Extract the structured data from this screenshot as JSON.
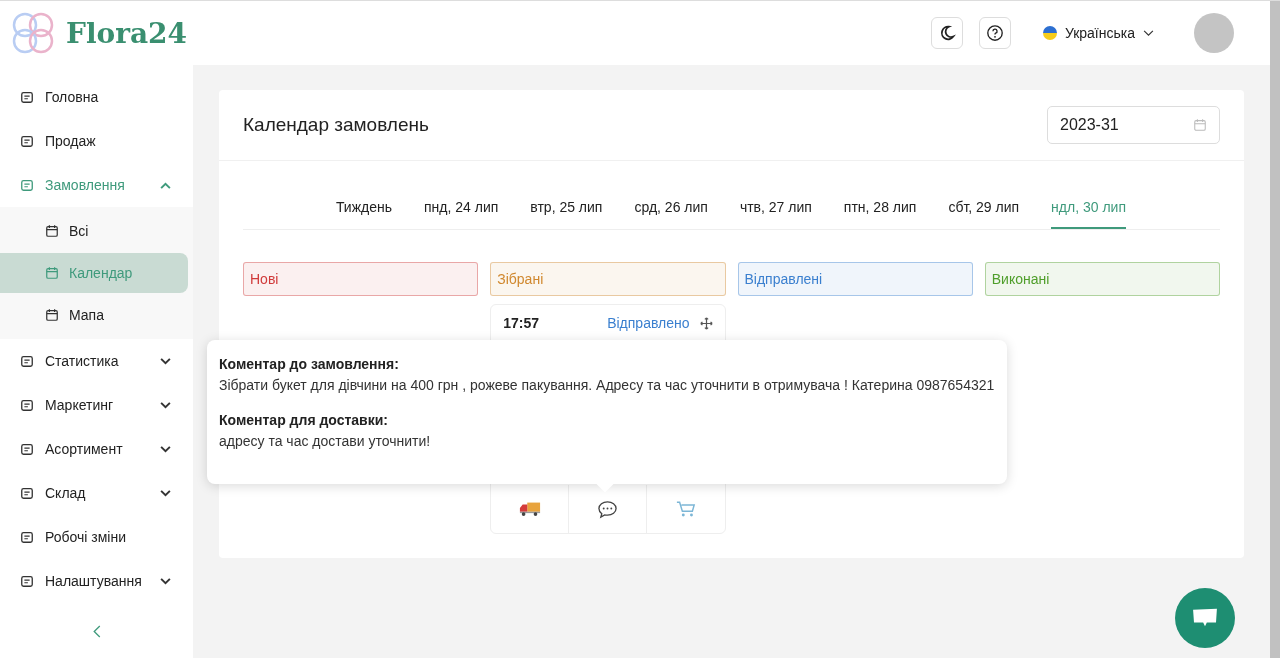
{
  "brand": {
    "name": "Flora24"
  },
  "header": {
    "language": "Українська"
  },
  "sidebar": {
    "items": [
      {
        "label": "Головна",
        "kind": "link",
        "active": false
      },
      {
        "label": "Продаж",
        "kind": "link",
        "active": false
      },
      {
        "label": "Замовлення",
        "kind": "group",
        "active": true,
        "expanded": true,
        "children": [
          {
            "label": "Всі",
            "selected": false
          },
          {
            "label": "Календар",
            "selected": true
          },
          {
            "label": "Мапа",
            "selected": false
          }
        ]
      },
      {
        "label": "Статистика",
        "kind": "group",
        "active": false,
        "expanded": false
      },
      {
        "label": "Маркетинг",
        "kind": "group",
        "active": false,
        "expanded": false
      },
      {
        "label": "Асортимент",
        "kind": "group",
        "active": false,
        "expanded": false
      },
      {
        "label": "Склад",
        "kind": "group",
        "active": false,
        "expanded": false
      },
      {
        "label": "Робочі зміни",
        "kind": "link",
        "active": false
      },
      {
        "label": "Налаштування",
        "kind": "group",
        "active": false,
        "expanded": false
      }
    ]
  },
  "calendar": {
    "title": "Календар замовлень",
    "week_field": {
      "value": "2023-31"
    },
    "tabs": [
      {
        "label": "Тиждень",
        "selected": false
      },
      {
        "label": "пнд, 24 лип",
        "selected": false
      },
      {
        "label": "втр, 25 лип",
        "selected": false
      },
      {
        "label": "срд, 26 лип",
        "selected": false
      },
      {
        "label": "чтв, 27 лип",
        "selected": false
      },
      {
        "label": "птн, 28 лип",
        "selected": false
      },
      {
        "label": "сбт, 29 лип",
        "selected": false
      },
      {
        "label": "ндл, 30 лип",
        "selected": true
      }
    ],
    "columns": [
      {
        "title": "Нові",
        "color": "#d03a3a"
      },
      {
        "title": "Зібрані",
        "color": "#d0882e",
        "orders": [
          {
            "time": "17:57",
            "status": "Відправлено"
          }
        ]
      },
      {
        "title": "Відправлені",
        "color": "#3a7fcf"
      },
      {
        "title": "Виконані",
        "color": "#4f9e2a"
      }
    ]
  },
  "tooltip": {
    "sections": [
      {
        "heading": "Коментар до замовлення:",
        "text": "Зібрати букет для дівчини на 400 грн , рожеве пакування. Адресу та час уточнити в отримувача ! Катерина 0987654321"
      },
      {
        "heading": "Коментар для доставки:",
        "text": "адресу та час достави уточнити!"
      }
    ]
  }
}
